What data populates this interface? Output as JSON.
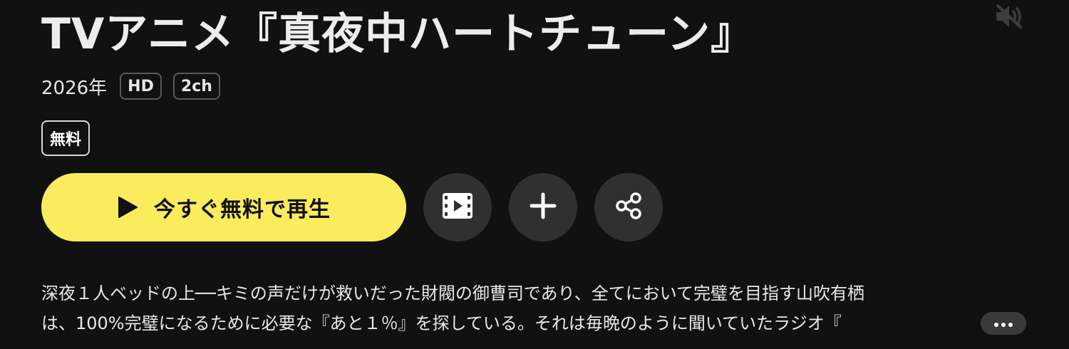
{
  "title": "TVアニメ『真夜中ハートチューン』",
  "meta": {
    "year": "2026年",
    "badges": [
      "HD",
      "2ch"
    ]
  },
  "price_badge": "無料",
  "actions": {
    "play_label": "今すぐ無料で再生",
    "trailer_icon": "film-icon",
    "add_icon": "plus-icon",
    "share_icon": "share-icon",
    "mute_icon": "volume-mute-icon"
  },
  "description": {
    "line1": "深夜１人ベッドの上──キミの声だけが救いだった財閥の御曹司であり、全てにおいて完璧を目指す山吹有栖",
    "line2": "は、100%完璧になるために必要な『あと１％』を探している。それは毎晩のように聞いていたラジオ『",
    "more_icon": "more-horizontal-icon"
  },
  "colors": {
    "background": "#111111",
    "play_button": "#fbec5d",
    "circle_button": "#303030"
  }
}
